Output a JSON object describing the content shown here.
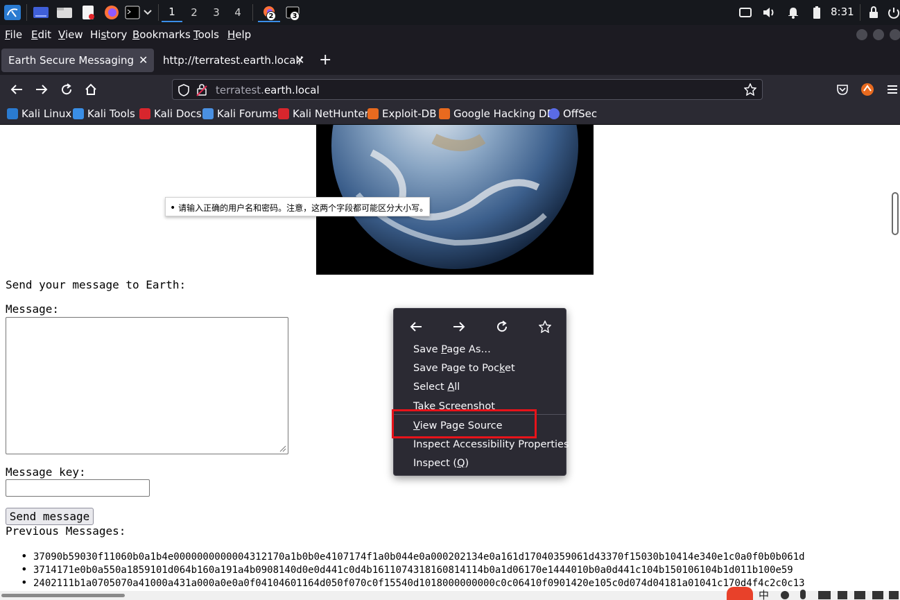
{
  "taskbar": {
    "workspaces": [
      "1",
      "2",
      "3",
      "4"
    ],
    "active_workspace": "1",
    "badges": [
      "2",
      "3"
    ],
    "clock": "8:31"
  },
  "menubar": {
    "items": [
      {
        "pre": "",
        "u": "F",
        "post": "ile"
      },
      {
        "pre": "",
        "u": "E",
        "post": "dit"
      },
      {
        "pre": "",
        "u": "V",
        "post": "iew"
      },
      {
        "pre": "Hi",
        "u": "s",
        "post": "tory"
      },
      {
        "pre": "",
        "u": "B",
        "post": "ookmarks"
      },
      {
        "pre": "",
        "u": "T",
        "post": "ools"
      },
      {
        "pre": "",
        "u": "H",
        "post": "elp"
      }
    ]
  },
  "tabs": [
    {
      "title": "Earth Secure Messaging",
      "active": true
    },
    {
      "title": "http://terratest.earth.local/",
      "active": false
    }
  ],
  "urlbar": {
    "prefix": "terratest.",
    "domain": "earth.local"
  },
  "bookmarks": [
    {
      "label": "Kali Linux",
      "color": "#2a7bd1"
    },
    {
      "label": "Kali Tools",
      "color": "#3a8ee6"
    },
    {
      "label": "Kali Docs",
      "color": "#d8262d"
    },
    {
      "label": "Kali Forums",
      "color": "#4a90e2"
    },
    {
      "label": "Kali NetHunter",
      "color": "#d8262d"
    },
    {
      "label": "Exploit-DB",
      "color": "#e86a1f"
    },
    {
      "label": "Google Hacking DB",
      "color": "#e86a1f"
    },
    {
      "label": "OffSec",
      "color": "#5a6be6"
    }
  ],
  "page": {
    "tooltip": "请输入正确的用户名和密码。注意，这两个字段都可能区分大小写。",
    "send_heading": "Send your message to Earth:",
    "message_label": "Message:",
    "message_value": "",
    "key_label": "Message key:",
    "key_value": "",
    "send_button": "Send message",
    "previous_heading": "Previous Messages:",
    "previous_messages": [
      "37090b59030f11060b0a1b4e0000000000004312170a1b0b0e4107174f1a0b044e0a000202134e0a161d17040359061d43370f15030b10414e340e1c0a0f0b0b061d",
      "3714171e0b0a550a1859101d064b160a191a4b0908140d0e0d441c0d4b1611074318160814114b0a1d06170e1444010b0a0d441c104b150106104b1d011b100e59",
      "2402111b1a0705070a41000a431a000a0e0a0f04104601164d050f070c0f15540d1018000000000c0c06410f0901420e105c0d074d04181a01041c170d4f4c2c0c13"
    ]
  },
  "context_menu": {
    "items": [
      {
        "pre": "Save ",
        "u": "P",
        "post": "age As…"
      },
      {
        "pre": "Save Page to Poc",
        "u": "k",
        "post": "et"
      },
      {
        "pre": "Select ",
        "u": "A",
        "post": "ll"
      },
      {
        "pre": "Take Screenshot",
        "u": "",
        "post": ""
      },
      {
        "pre": "",
        "u": "V",
        "post": "iew Page Source"
      },
      {
        "pre": "Inspect Accessibility Properties",
        "u": "",
        "post": ""
      },
      {
        "pre": "Inspect (",
        "u": "Q",
        "post": ")"
      }
    ],
    "highlighted": "View Page Source",
    "highlight_color": "#e8131a"
  },
  "colors": {
    "panel": "#16181d",
    "chrome_dark": "#1c1b22",
    "chrome": "#2b2a33",
    "accent": "#3b8ee8",
    "sogou": "#e8412a"
  },
  "tray": {
    "ime_label": "中"
  }
}
